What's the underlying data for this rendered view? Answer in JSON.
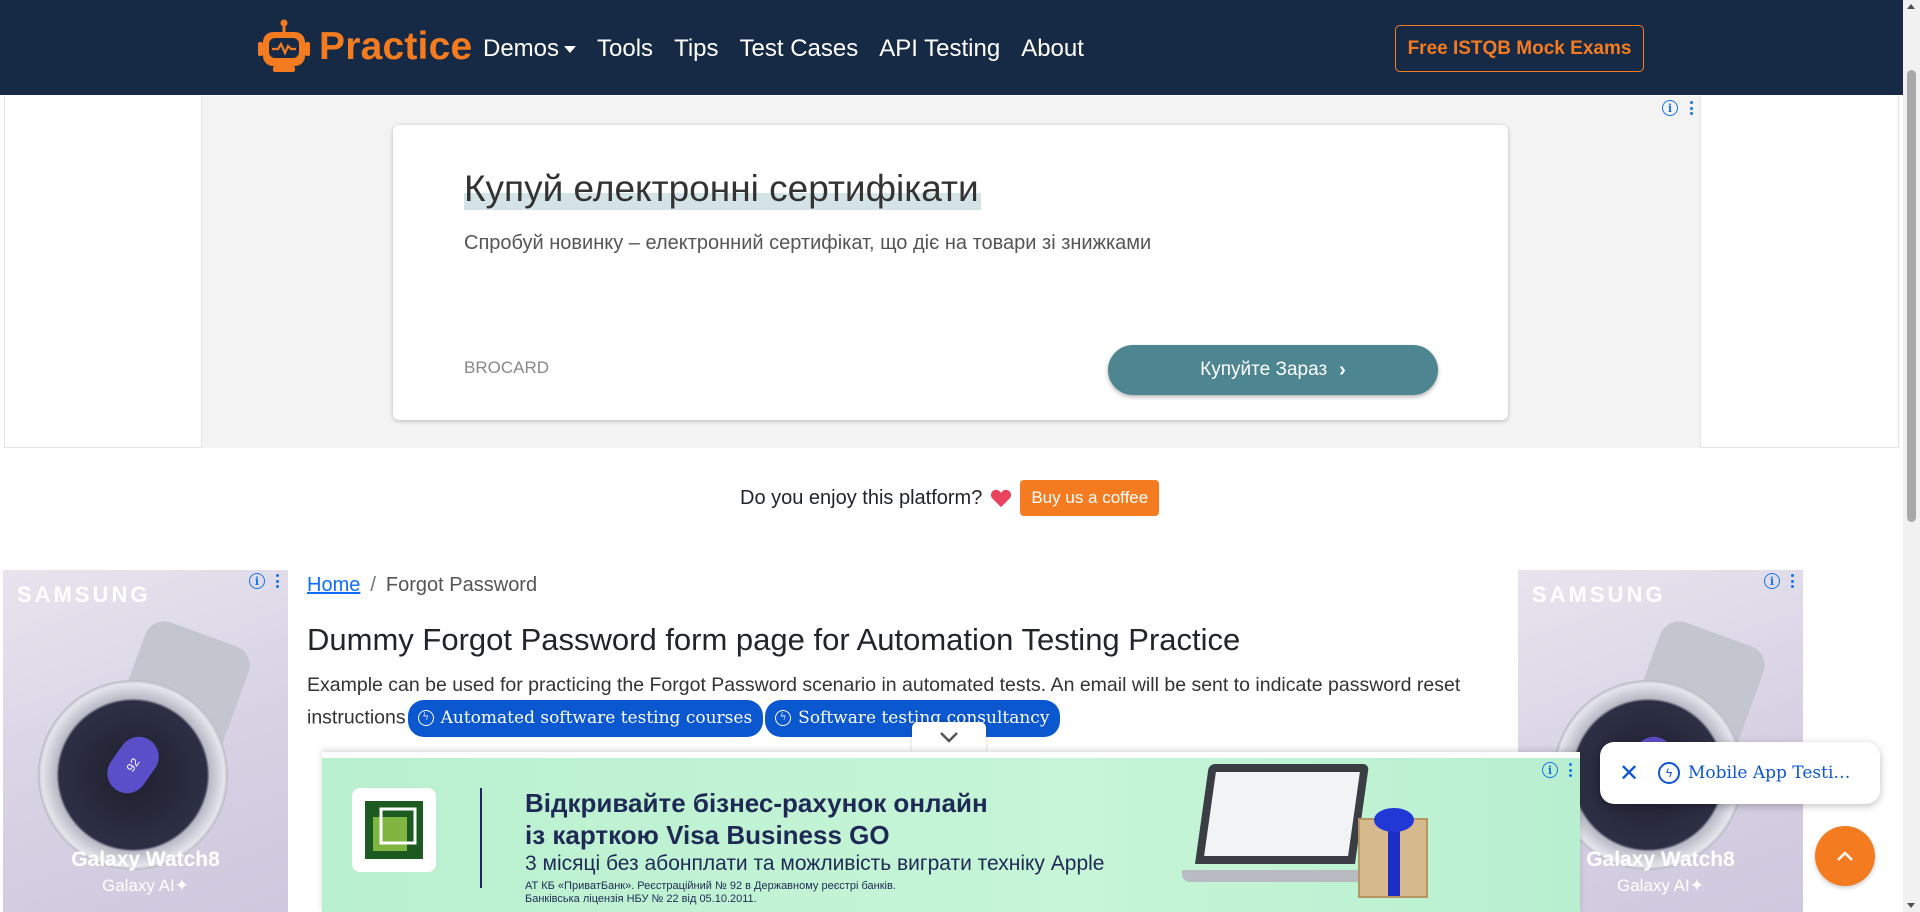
{
  "navbar": {
    "brand": "Practice",
    "links": [
      {
        "label": "Demos",
        "dropdown": true
      },
      {
        "label": "Tools"
      },
      {
        "label": "Tips"
      },
      {
        "label": "Test Cases"
      },
      {
        "label": "API Testing"
      },
      {
        "label": "About"
      }
    ],
    "cta": "Free ISTQB Mock Exams"
  },
  "top_ad": {
    "headline": "Купуй електронні сертифікати",
    "description": "Спробуй новинку – електронний сертифікат, що діє на товари зі знижками",
    "brand": "BROCARD",
    "button": "Купуйте Зараз"
  },
  "coffee": {
    "text": "Do you enjoy this platform?",
    "button": "Buy us a coffee"
  },
  "side_ad": {
    "brand": "SAMSUNG",
    "product": "Galaxy Watch8",
    "tagline": "Galaxy AI✦",
    "watch_label": "92"
  },
  "breadcrumb": {
    "home": "Home",
    "current": "Forgot Password"
  },
  "main": {
    "title": "Dummy Forgot Password form page for Automation Testing Practice",
    "description": "Example can be used for practicing the Forgot Password scenario in automated tests. An email will be sent to indicate password reset instructions",
    "pills": [
      "Automated software testing courses",
      "Software testing consultancy"
    ]
  },
  "bottom_ad": {
    "line1": "Відкривайте бізнес-рахунок онлайн",
    "line2": "із карткою Visa Business GO",
    "line3": "3 місяці без абонплати та можливість виграти техніку Apple",
    "small1": "АТ КБ «ПриватБанк». Реєстраційний № 92 в Державному реєстрі банків.",
    "small2": "Банківська ліцензія НБУ № 22 від 05.10.2011."
  },
  "toast": {
    "text": "Mobile App Testi…"
  },
  "colors": {
    "navbar_bg": "#172a45",
    "accent": "#f47b20",
    "ad_button": "#4d8590",
    "pill_blue": "#0b57d0",
    "bottom_ad_bg": "#c6f5d7"
  }
}
